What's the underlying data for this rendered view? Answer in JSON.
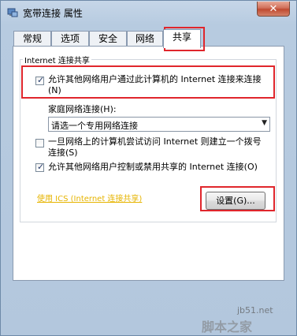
{
  "window": {
    "title": "宽带连接 属性"
  },
  "close_glyph": "✕",
  "tabs": [
    {
      "label": "常规"
    },
    {
      "label": "选项"
    },
    {
      "label": "安全"
    },
    {
      "label": "网络"
    },
    {
      "label": "共享",
      "active": true
    }
  ],
  "sharing": {
    "group_title": "Internet 连接共享",
    "allow_share": {
      "label": "允许其他网络用户通过此计算机的 Internet 连接来连接(N)",
      "checked": true
    },
    "home_network_label": "家庭网络连接(H):",
    "home_network_value": "请选一个专用网络连接",
    "dial_on_demand": {
      "label": "一旦网络上的计算机尝试访问 Internet 则建立一个拨号连接(S)",
      "checked": false
    },
    "allow_control": {
      "label": "允许其他网络用户控制或禁用共享的 Internet 连接(O)",
      "checked": true
    },
    "ics_link": "使用 ICS (Internet 连接共享)",
    "settings_button": "设置(G)..."
  },
  "watermark": {
    "line1": "jb51.net",
    "line2": "脚本之家"
  },
  "colors": {
    "highlight": "#e0262c",
    "link": "#e6b400"
  }
}
